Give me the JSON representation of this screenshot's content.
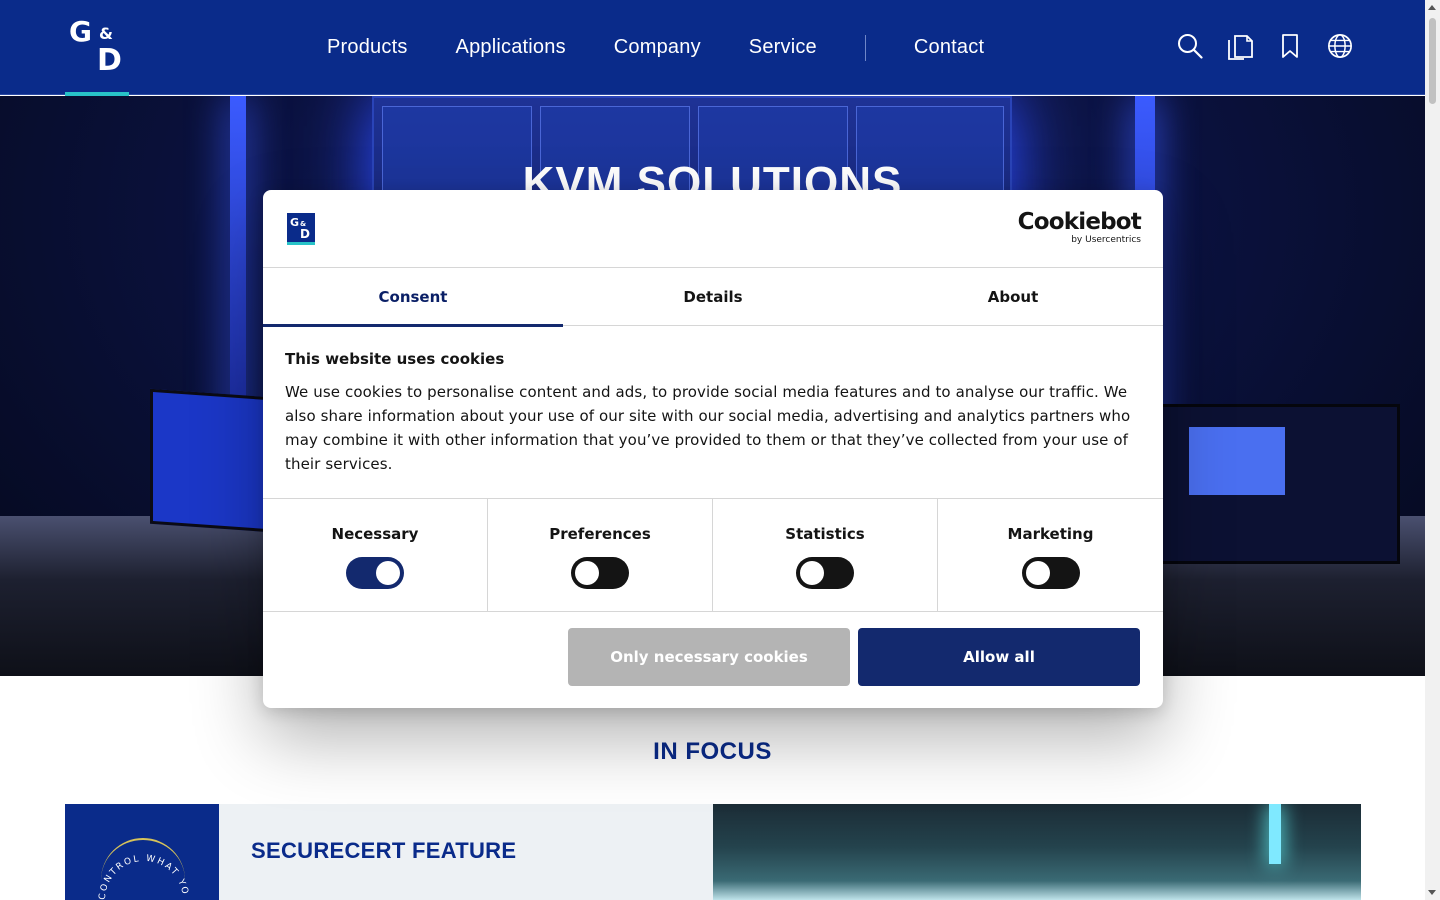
{
  "header": {
    "logo_alt": "G&D",
    "logo_parts": {
      "g": "G",
      "amp": "&",
      "d": "D"
    },
    "nav": [
      {
        "label": "Products"
      },
      {
        "label": "Applications"
      },
      {
        "label": "Company"
      },
      {
        "label": "Service"
      },
      {
        "label": "Contact"
      }
    ],
    "icons": [
      "search-icon",
      "documents-icon",
      "bookmark-icon",
      "globe-icon"
    ]
  },
  "hero": {
    "title": "KVM SOLUTIONS"
  },
  "in_focus": {
    "heading": "IN FOCUS",
    "card": {
      "badge_text": "CONTROL WHAT YOU SEE",
      "title": "SECURECERT FEATURE"
    }
  },
  "cookie_dialog": {
    "logo": {
      "g": "G",
      "amp": "&",
      "d": "D"
    },
    "provider": "Cookiebot",
    "provider_sub": "by Usercentrics",
    "tabs": [
      {
        "label": "Consent",
        "active": true
      },
      {
        "label": "Details",
        "active": false
      },
      {
        "label": "About",
        "active": false
      }
    ],
    "title": "This website uses cookies",
    "body": "We use cookies to personalise content and ads, to provide social media features and to analyse our traffic. We also share information about your use of our site with our social media, advertising and analytics partners who may combine it with other information that you’ve provided to them or that they’ve collected from your use of their services.",
    "categories": [
      {
        "label": "Necessary",
        "enabled": true
      },
      {
        "label": "Preferences",
        "enabled": false
      },
      {
        "label": "Statistics",
        "enabled": false
      },
      {
        "label": "Marketing",
        "enabled": false
      }
    ],
    "buttons": {
      "necessary_only": "Only necessary cookies",
      "allow_all": "Allow all"
    }
  },
  "colors": {
    "brand_blue": "#0a2b8a",
    "accent_teal": "#28c3c8",
    "dialog_blue": "#13296e",
    "button_grey": "#b4b4b4"
  }
}
